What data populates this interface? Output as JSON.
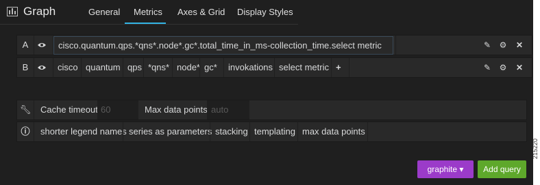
{
  "header": {
    "title": "Graph",
    "tabs": [
      {
        "label": "General",
        "active": false
      },
      {
        "label": "Metrics",
        "active": true
      },
      {
        "label": "Axes & Grid",
        "active": false
      },
      {
        "label": "Display Styles",
        "active": false
      }
    ]
  },
  "queries": [
    {
      "ref": "A",
      "text": "cisco.quantum.qps.*qns*.node*.gc*.total_time_in_ms-collection_time.select metric"
    },
    {
      "ref": "B",
      "segments": [
        "cisco",
        "quantum",
        "qps",
        "*qns*",
        "node*",
        "gc*",
        "invokations",
        "select metric"
      ],
      "add_symbol": "+"
    }
  ],
  "options": {
    "cache_timeout_label": "Cache timeout",
    "cache_timeout_placeholder": "60",
    "max_points_label": "Max data points",
    "max_points_placeholder": "auto"
  },
  "help": {
    "items": [
      "shorter legend names",
      "series as parameters",
      "stacking",
      "templating",
      "max data points"
    ]
  },
  "buttons": {
    "datasource": "graphite",
    "add_query": "Add query"
  },
  "colors": {
    "panel_bg": "#1f1f1f",
    "row_bg": "#292929",
    "active_tab": "#33b5e5",
    "datasource_btn": "#9b3bc9",
    "add_query_btn": "#5ea82b"
  },
  "figure_number": "215220"
}
